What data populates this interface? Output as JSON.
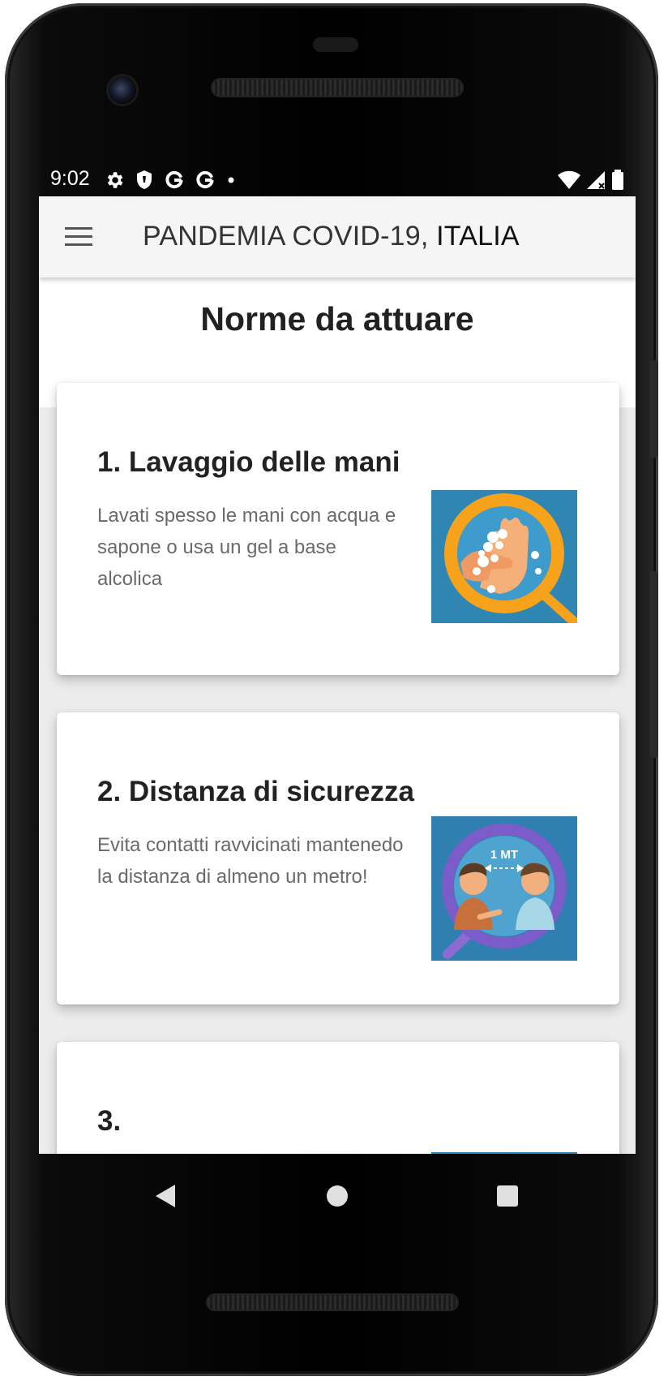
{
  "status_bar": {
    "time": "9:02",
    "left_icons": [
      "settings-icon",
      "shield-icon",
      "google-g-icon",
      "google-g-icon",
      "dot-icon"
    ],
    "right_icons": [
      "wifi-icon",
      "cellular-signal-icon",
      "battery-icon"
    ]
  },
  "app_bar": {
    "menu_icon": "hamburger-menu-icon",
    "title_part1": "PANDEMIA COVID-19, ",
    "title_part2": "ITALIA"
  },
  "page": {
    "title": "Norme da attuare"
  },
  "cards": [
    {
      "title": "1. Lavaggio delle mani",
      "text": "Lavati spesso le mani con acqua e sapone o usa un gel a base alcolica",
      "image": "handwashing-illustration"
    },
    {
      "title": "2. Distanza di sicurezza",
      "text": "Evita contatti ravvicinati mantenedo la distanza di almeno un metro!",
      "image": "social-distance-illustration",
      "image_label": "1 MT"
    },
    {
      "title": "3.",
      "text": "",
      "image": "partial-illustration"
    }
  ],
  "nav_bar": {
    "back": "back-triangle-icon",
    "home": "home-circle-icon",
    "recents": "recents-square-icon"
  },
  "colors": {
    "app_bar_bg": "#f5f5f5",
    "screen_bg": "#ececec",
    "card_bg": "#ffffff",
    "image_blue": "#2f86b3",
    "ring_orange": "#f6a21a",
    "ring_purple": "#7b5cc9"
  }
}
